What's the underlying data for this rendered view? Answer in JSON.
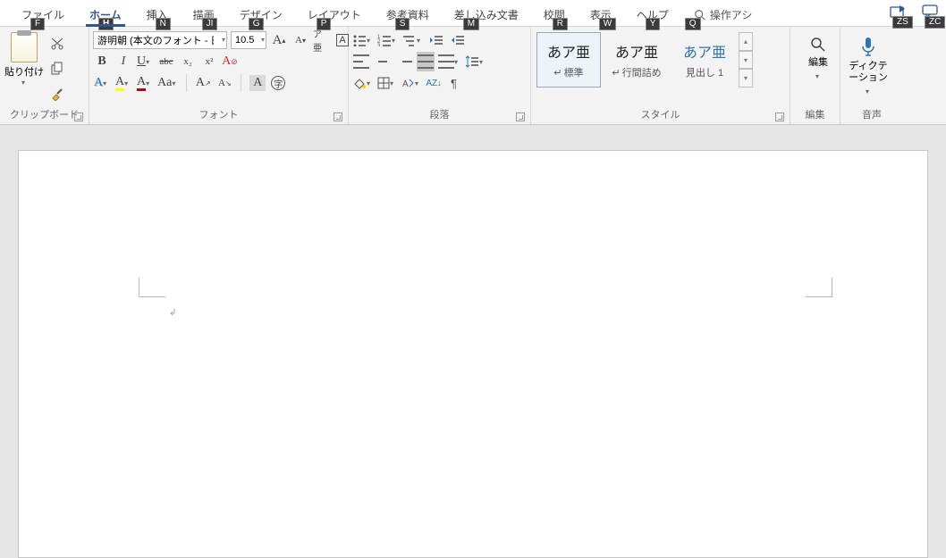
{
  "tabs": {
    "file": {
      "label": "ファイル",
      "key": "F"
    },
    "home": {
      "label": "ホーム",
      "key": "H"
    },
    "insert": {
      "label": "挿入",
      "key": "N"
    },
    "draw": {
      "label": "描画",
      "key": "JI"
    },
    "design": {
      "label": "デザイン",
      "key": "G"
    },
    "layout": {
      "label": "レイアウト",
      "key": "P"
    },
    "ref": {
      "label": "参考資料",
      "key": "S"
    },
    "mail": {
      "label": "差し込み文書",
      "key": "M"
    },
    "review": {
      "label": "校閲",
      "key": "R"
    },
    "view": {
      "label": "表示",
      "key": "W"
    },
    "help": {
      "label": "ヘルプ",
      "key": "Y"
    },
    "search": {
      "label": "操作アシ",
      "key": "Q"
    }
  },
  "topright": {
    "share_key": "ZS",
    "comments_key": "ZC"
  },
  "clipboard": {
    "group": "クリップボード",
    "paste": "貼り付け"
  },
  "font": {
    "group": "フォント",
    "name": "游明朝 (本文のフォント - 日",
    "size": "10.5",
    "B": "B",
    "I": "I",
    "U": "U",
    "abc": "abc",
    "x2sub": "x₂",
    "x2sup": "x²",
    "A_outline": "A",
    "A_hl": "A",
    "A_color": "A",
    "Aa": "Aa",
    "Aup": "A",
    "Adn": "A",
    "A_boxed": "A",
    "ruby": "ア亜",
    "enclose": "字",
    "bigA": "A",
    "smlA": "A"
  },
  "para": {
    "group": "段落",
    "az": "A",
    "za": "Z"
  },
  "styles": {
    "group": "スタイル",
    "sample": "あア亜",
    "s1": "標準",
    "s2": "行間詰め",
    "s3": "見出し 1",
    "para_glyph": "↵"
  },
  "editing": {
    "group": "編集",
    "label": "編集"
  },
  "voice": {
    "group": "音声",
    "label": "ディクテーション"
  },
  "doc": {
    "para_mark": "↲"
  }
}
